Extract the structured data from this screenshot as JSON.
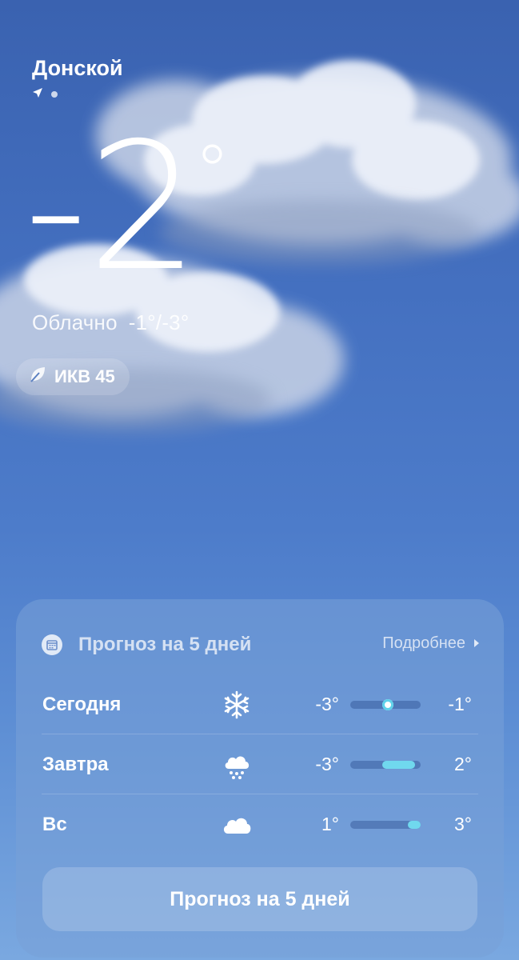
{
  "location": {
    "city": "Донской"
  },
  "current": {
    "temperature": "-2",
    "degree": "°",
    "condition": "Облачно",
    "range": "-1°/-3°",
    "aqi_label": "ИКВ 45"
  },
  "forecast": {
    "title": "Прогноз на 5 дней",
    "more_label": "Подробнее",
    "days": [
      {
        "day": "Сегодня",
        "icon": "snowflake-icon",
        "low": "-3°",
        "high": "-1°",
        "bar_start": 0.5,
        "bar_end": 0.5,
        "current_marker": true
      },
      {
        "day": "Завтра",
        "icon": "snow-cloud-icon",
        "low": "-3°",
        "high": "2°",
        "bar_start": 0.45,
        "bar_end": 0.92,
        "current_marker": false
      },
      {
        "day": "Вс",
        "icon": "cloud-icon",
        "low": "1°",
        "high": "3°",
        "bar_start": 0.82,
        "bar_end": 1.0,
        "current_marker": false
      }
    ],
    "button_label": "Прогноз на 5 дней"
  },
  "colors": {
    "bar_fill": "#70d8ee",
    "sky_top": "#3a62b0",
    "sky_bottom": "#7aa8e0"
  }
}
